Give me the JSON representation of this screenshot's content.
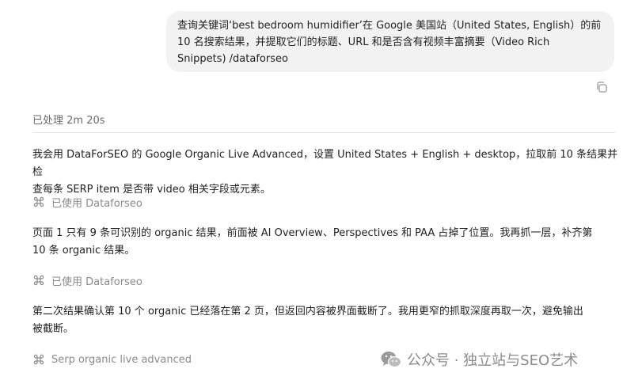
{
  "user_message": {
    "line1": "查询关键词‘best bedroom humidifier’在 Google 美国站（United States, English）的前",
    "line2": "10 名搜索结果，并提取它们的标题、URL 和是否含有视频丰富摘要（Video Rich",
    "line3": "Snippets) /dataforseo"
  },
  "processed_label": "已处理 2m 20s",
  "blocks": {
    "p1_line1": "我会用 DataForSEO 的 Google Organic Live Advanced，设置 United States + English + desktop，拉取前 10 条结果并检",
    "p1_line2": "查每条 SERP item 是否带 video 相关字段或元素。",
    "tool1": "已使用 Dataforseo",
    "p2_line1": "页面 1 只有 9 条可识别的 organic 结果，前面被 AI Overview、Perspectives 和 PAA 占掉了位置。我再抓一层，补齐第",
    "p2_line2": "10 条 organic 结果。",
    "tool2": "已使用 Dataforseo",
    "p3_line1": "第二次结果确认第 10 个 organic 已经落在第 2 页，但返回内容被界面截断了。我用更窄的抓取深度再取一次，避免输出",
    "p3_line2": "被截断。",
    "tool3": "Serp organic live advanced"
  },
  "watermark": {
    "text": "公众号 · 独立站与SEO艺术"
  },
  "icons": {
    "copy": "copy-icon",
    "tool": "command-icon",
    "wechat": "wechat-icon"
  }
}
